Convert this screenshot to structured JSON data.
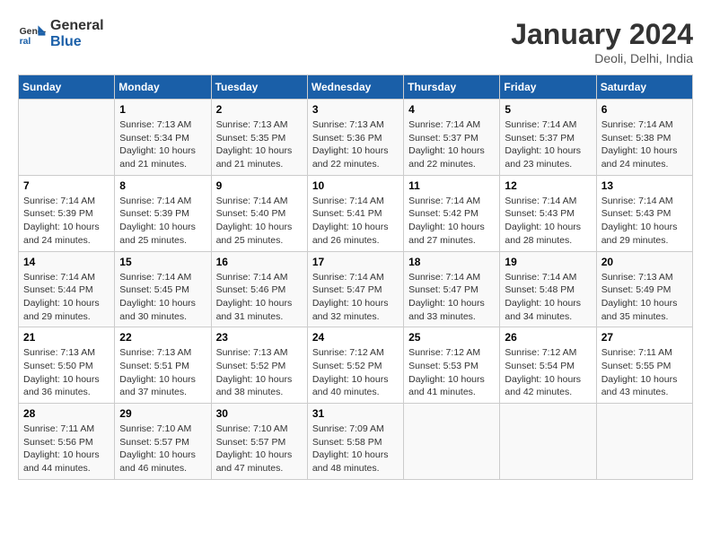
{
  "header": {
    "logo_line1": "General",
    "logo_line2": "Blue",
    "month_title": "January 2024",
    "subtitle": "Deoli, Delhi, India"
  },
  "weekdays": [
    "Sunday",
    "Monday",
    "Tuesday",
    "Wednesday",
    "Thursday",
    "Friday",
    "Saturday"
  ],
  "weeks": [
    [
      {
        "day": "",
        "info": ""
      },
      {
        "day": "1",
        "info": "Sunrise: 7:13 AM\nSunset: 5:34 PM\nDaylight: 10 hours\nand 21 minutes."
      },
      {
        "day": "2",
        "info": "Sunrise: 7:13 AM\nSunset: 5:35 PM\nDaylight: 10 hours\nand 21 minutes."
      },
      {
        "day": "3",
        "info": "Sunrise: 7:13 AM\nSunset: 5:36 PM\nDaylight: 10 hours\nand 22 minutes."
      },
      {
        "day": "4",
        "info": "Sunrise: 7:14 AM\nSunset: 5:37 PM\nDaylight: 10 hours\nand 22 minutes."
      },
      {
        "day": "5",
        "info": "Sunrise: 7:14 AM\nSunset: 5:37 PM\nDaylight: 10 hours\nand 23 minutes."
      },
      {
        "day": "6",
        "info": "Sunrise: 7:14 AM\nSunset: 5:38 PM\nDaylight: 10 hours\nand 24 minutes."
      }
    ],
    [
      {
        "day": "7",
        "info": "Sunrise: 7:14 AM\nSunset: 5:39 PM\nDaylight: 10 hours\nand 24 minutes."
      },
      {
        "day": "8",
        "info": "Sunrise: 7:14 AM\nSunset: 5:39 PM\nDaylight: 10 hours\nand 25 minutes."
      },
      {
        "day": "9",
        "info": "Sunrise: 7:14 AM\nSunset: 5:40 PM\nDaylight: 10 hours\nand 25 minutes."
      },
      {
        "day": "10",
        "info": "Sunrise: 7:14 AM\nSunset: 5:41 PM\nDaylight: 10 hours\nand 26 minutes."
      },
      {
        "day": "11",
        "info": "Sunrise: 7:14 AM\nSunset: 5:42 PM\nDaylight: 10 hours\nand 27 minutes."
      },
      {
        "day": "12",
        "info": "Sunrise: 7:14 AM\nSunset: 5:43 PM\nDaylight: 10 hours\nand 28 minutes."
      },
      {
        "day": "13",
        "info": "Sunrise: 7:14 AM\nSunset: 5:43 PM\nDaylight: 10 hours\nand 29 minutes."
      }
    ],
    [
      {
        "day": "14",
        "info": "Sunrise: 7:14 AM\nSunset: 5:44 PM\nDaylight: 10 hours\nand 29 minutes."
      },
      {
        "day": "15",
        "info": "Sunrise: 7:14 AM\nSunset: 5:45 PM\nDaylight: 10 hours\nand 30 minutes."
      },
      {
        "day": "16",
        "info": "Sunrise: 7:14 AM\nSunset: 5:46 PM\nDaylight: 10 hours\nand 31 minutes."
      },
      {
        "day": "17",
        "info": "Sunrise: 7:14 AM\nSunset: 5:47 PM\nDaylight: 10 hours\nand 32 minutes."
      },
      {
        "day": "18",
        "info": "Sunrise: 7:14 AM\nSunset: 5:47 PM\nDaylight: 10 hours\nand 33 minutes."
      },
      {
        "day": "19",
        "info": "Sunrise: 7:14 AM\nSunset: 5:48 PM\nDaylight: 10 hours\nand 34 minutes."
      },
      {
        "day": "20",
        "info": "Sunrise: 7:13 AM\nSunset: 5:49 PM\nDaylight: 10 hours\nand 35 minutes."
      }
    ],
    [
      {
        "day": "21",
        "info": "Sunrise: 7:13 AM\nSunset: 5:50 PM\nDaylight: 10 hours\nand 36 minutes."
      },
      {
        "day": "22",
        "info": "Sunrise: 7:13 AM\nSunset: 5:51 PM\nDaylight: 10 hours\nand 37 minutes."
      },
      {
        "day": "23",
        "info": "Sunrise: 7:13 AM\nSunset: 5:52 PM\nDaylight: 10 hours\nand 38 minutes."
      },
      {
        "day": "24",
        "info": "Sunrise: 7:12 AM\nSunset: 5:52 PM\nDaylight: 10 hours\nand 40 minutes."
      },
      {
        "day": "25",
        "info": "Sunrise: 7:12 AM\nSunset: 5:53 PM\nDaylight: 10 hours\nand 41 minutes."
      },
      {
        "day": "26",
        "info": "Sunrise: 7:12 AM\nSunset: 5:54 PM\nDaylight: 10 hours\nand 42 minutes."
      },
      {
        "day": "27",
        "info": "Sunrise: 7:11 AM\nSunset: 5:55 PM\nDaylight: 10 hours\nand 43 minutes."
      }
    ],
    [
      {
        "day": "28",
        "info": "Sunrise: 7:11 AM\nSunset: 5:56 PM\nDaylight: 10 hours\nand 44 minutes."
      },
      {
        "day": "29",
        "info": "Sunrise: 7:10 AM\nSunset: 5:57 PM\nDaylight: 10 hours\nand 46 minutes."
      },
      {
        "day": "30",
        "info": "Sunrise: 7:10 AM\nSunset: 5:57 PM\nDaylight: 10 hours\nand 47 minutes."
      },
      {
        "day": "31",
        "info": "Sunrise: 7:09 AM\nSunset: 5:58 PM\nDaylight: 10 hours\nand 48 minutes."
      },
      {
        "day": "",
        "info": ""
      },
      {
        "day": "",
        "info": ""
      },
      {
        "day": "",
        "info": ""
      }
    ]
  ]
}
